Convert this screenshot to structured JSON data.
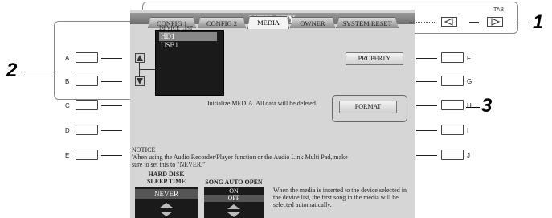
{
  "screen": {
    "title": "UTILITY",
    "tabs": [
      {
        "label": "CONFIG 1",
        "active": false
      },
      {
        "label": "CONFIG 2",
        "active": false
      },
      {
        "label": "MEDIA",
        "active": true
      },
      {
        "label": "OWNER",
        "active": false
      },
      {
        "label": "SYSTEM RESET",
        "active": false
      }
    ],
    "tab_label": "TAB",
    "tab_prev_icon": "triangle-left-icon",
    "tab_next_icon": "triangle-right-icon",
    "device_list": {
      "title": "DEVICE LIST",
      "items": [
        {
          "label": "HD1",
          "selected": true
        },
        {
          "label": "USB1",
          "selected": false
        }
      ],
      "scroll_up_icon": "triangle-up-icon",
      "scroll_down_icon": "triangle-down-icon"
    },
    "property_label": "PROPERTY",
    "format_label": "FORMAT",
    "init_text": "Initialize MEDIA. All data will be deleted.",
    "notice": "NOTICE\nWhen using the Audio Recorder/Player function or the Audio Link Multi Pad, make sure to set this to \"NEVER.\"",
    "hard_disk": {
      "label": "HARD DISK\nSLEEP TIME",
      "value": "NEVER"
    },
    "song_auto_open": {
      "label": "SONG AUTO OPEN",
      "options": [
        {
          "label": "ON",
          "selected": false
        },
        {
          "label": "OFF",
          "selected": true
        }
      ],
      "description": "When the media is inserted to the device selected in the device list, the first song in the media will be selected automatically."
    }
  },
  "left_buttons": [
    "A",
    "B",
    "C",
    "D",
    "E"
  ],
  "right_buttons": [
    "F",
    "G",
    "H",
    "I",
    "J"
  ],
  "callouts": [
    "1",
    "2",
    "3"
  ]
}
